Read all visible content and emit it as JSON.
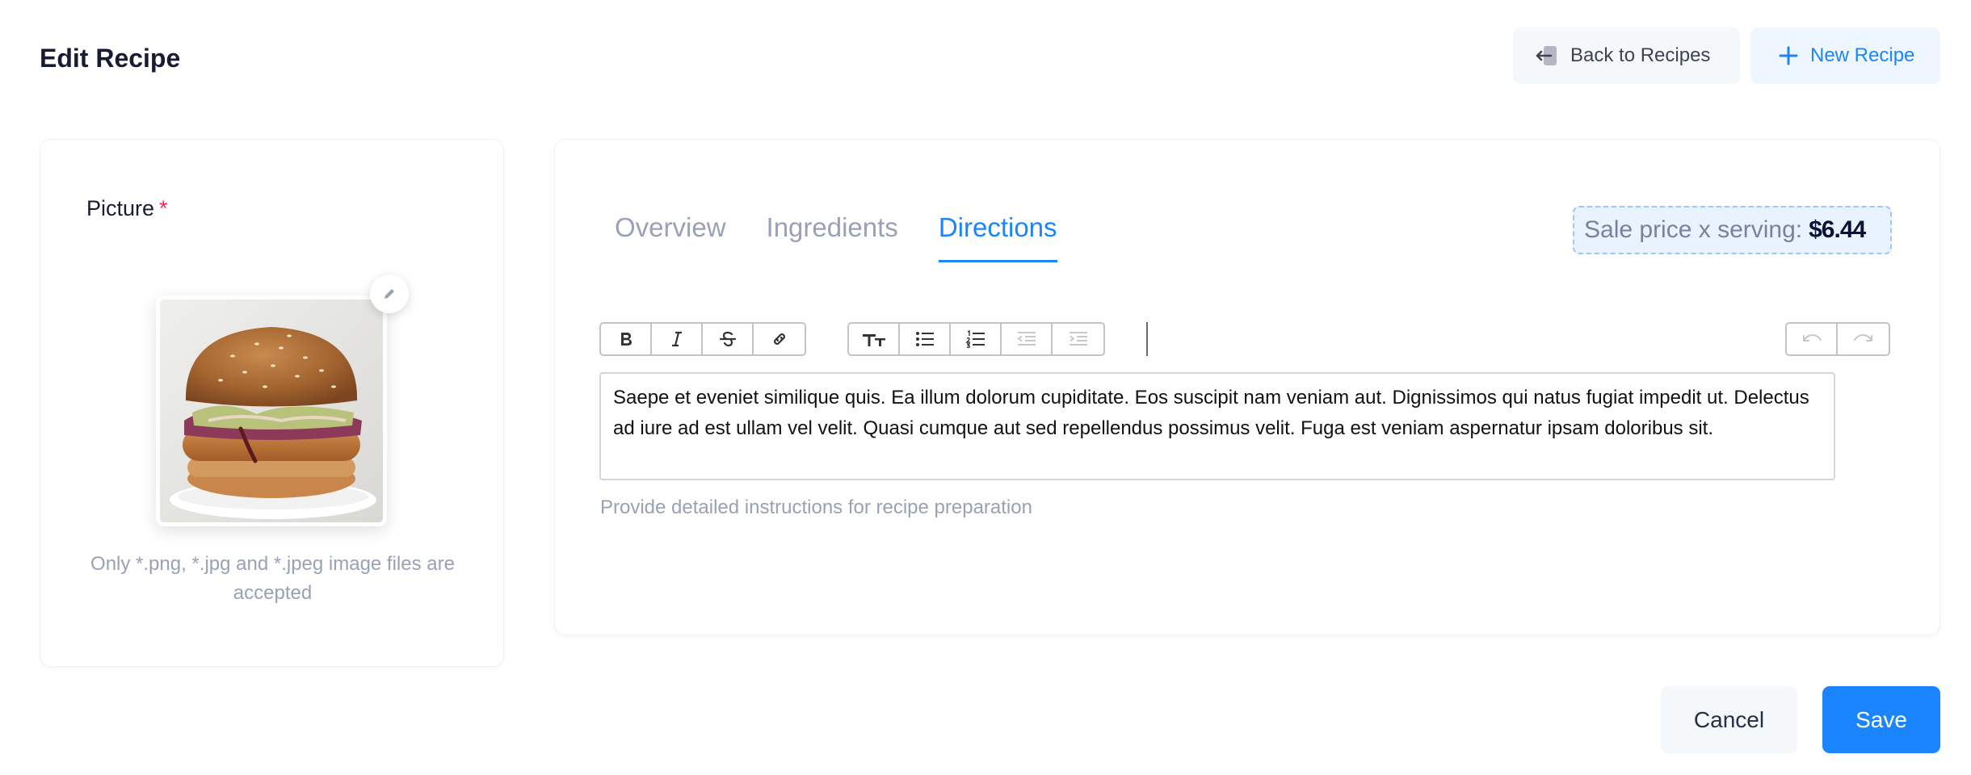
{
  "header": {
    "title": "Edit Recipe",
    "back_label": "Back to Recipes",
    "new_label": "New Recipe"
  },
  "picture": {
    "label": "Picture",
    "required_mark": "*",
    "hint": "Only *.png, *.jpg and *.jpeg image files are accepted",
    "image_alt": "burger"
  },
  "tabs": [
    {
      "label": "Overview",
      "active": false
    },
    {
      "label": "Ingredients",
      "active": false
    },
    {
      "label": "Directions",
      "active": true
    }
  ],
  "price": {
    "label": "Sale price x serving:",
    "value": "$6.44"
  },
  "toolbar": {
    "format_group": [
      "bold-icon",
      "italic-icon",
      "strikethrough-icon",
      "link-icon"
    ],
    "block_group": [
      "text-size-icon",
      "bullet-list-icon",
      "numbered-list-icon",
      "outdent-icon",
      "indent-icon"
    ],
    "history_group": [
      "undo-icon",
      "redo-icon"
    ]
  },
  "editor": {
    "content": "Saepe et eveniet similique quis. Ea illum dolorum cupiditate. Eos suscipit nam veniam aut. Dignissimos qui natus fugiat impedit ut. Delectus ad iure ad est ullam vel velit. Quasi cumque aut sed repellendus possimus velit. Fuga est veniam aspernatur ipsam doloribus sit.",
    "help": "Provide detailed instructions for recipe preparation"
  },
  "footer": {
    "cancel_label": "Cancel",
    "save_label": "Save"
  },
  "colors": {
    "primary": "#1b84ff",
    "required": "#f8285a",
    "muted": "#99a1b7"
  }
}
